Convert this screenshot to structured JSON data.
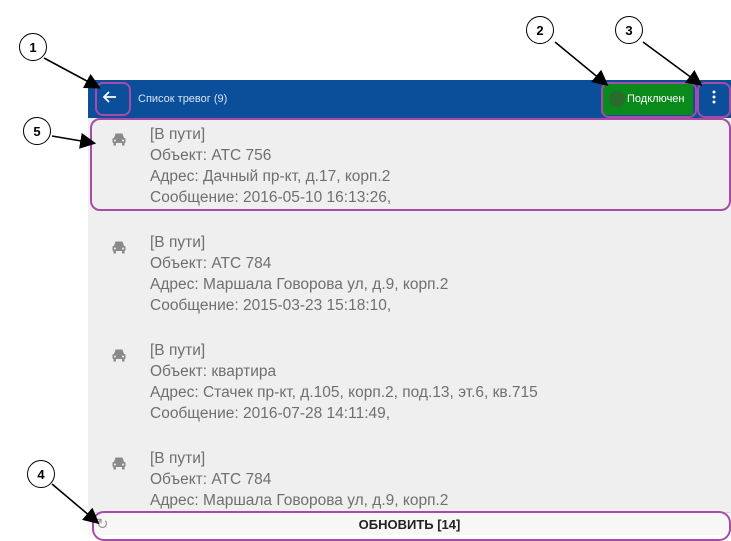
{
  "header": {
    "back_icon": "arrow-left-icon",
    "title": "Список тревог (9)",
    "status_label": "Подключен",
    "status_color": "#0b8a1c",
    "menu_icon": "more-vert-icon",
    "bar_color": "#0b4f9b"
  },
  "alarms": [
    {
      "icon": "car-icon",
      "state": "[В пути]",
      "object": "Объект: АТС 756",
      "address": "Адрес: Дачный пр-кт, д.17, корп.2",
      "message": "Сообщение: 2016-05-10 16:13:26,"
    },
    {
      "icon": "car-icon",
      "state": "[В пути]",
      "object": "Объект: АТС 784",
      "address": "Адрес: Маршала Говорова ул, д.9, корп.2",
      "message": "Сообщение: 2015-03-23 15:18:10,"
    },
    {
      "icon": "car-icon",
      "state": "[В пути]",
      "object": "Объект: квартира",
      "address": "Адрес: Стачек пр-кт, д.105, корп.2, под.13, эт.6, кв.715",
      "message": "Сообщение: 2016-07-28 14:11:49,"
    },
    {
      "icon": "car-icon",
      "state": "[В пути]",
      "object": "Объект: АТС 784",
      "address": "Адрес: Маршала Говорова ул, д.9, корп.2",
      "message": ""
    }
  ],
  "footer": {
    "refresh_icon": "refresh-icon",
    "refresh_label": "ОБНОВИТЬ [14]"
  },
  "annotations": {
    "color": "#a64ca6",
    "callouts": [
      "1",
      "2",
      "3",
      "4",
      "5"
    ]
  }
}
